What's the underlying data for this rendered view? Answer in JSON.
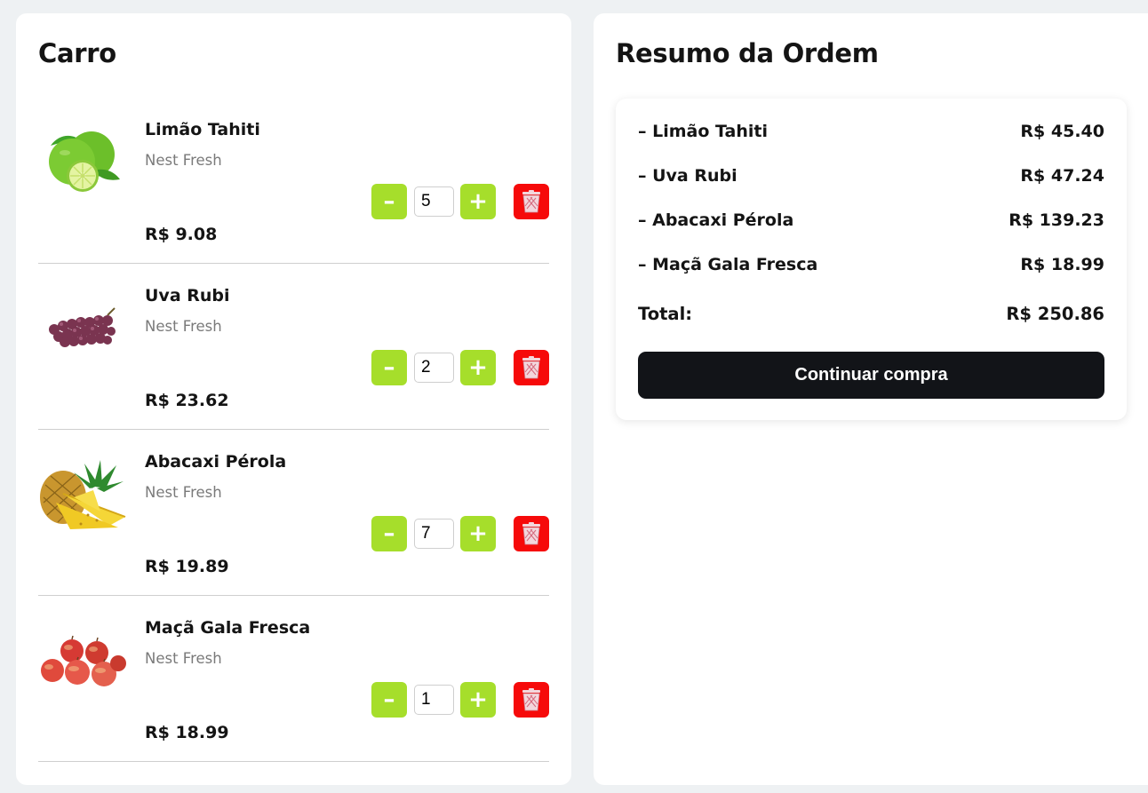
{
  "cart": {
    "title": "Carro",
    "items": [
      {
        "name": "Limão Tahiti",
        "brand": "Nest Fresh",
        "price": "R$ 9.08",
        "quantity": "5",
        "image": "lime-image"
      },
      {
        "name": "Uva Rubi",
        "brand": "Nest Fresh",
        "price": "R$ 23.62",
        "quantity": "2",
        "image": "grapes-image"
      },
      {
        "name": "Abacaxi Pérola",
        "brand": "Nest Fresh",
        "price": "R$ 19.89",
        "quantity": "7",
        "image": "pineapple-image"
      },
      {
        "name": "Maçã Gala Fresca",
        "brand": "Nest Fresh",
        "price": "R$ 18.99",
        "quantity": "1",
        "image": "apples-image"
      }
    ],
    "minus_label": "–",
    "plus_label": "+",
    "delete_icon": "trash-icon"
  },
  "summary": {
    "title": "Resumo da Ordem",
    "lines": [
      {
        "name": "– Limão Tahiti",
        "price": "R$ 45.40"
      },
      {
        "name": "– Uva Rubi",
        "price": "R$ 47.24"
      },
      {
        "name": "– Abacaxi Pérola",
        "price": "R$ 139.23"
      },
      {
        "name": "– Maçã Gala Fresca",
        "price": "R$ 18.99"
      }
    ],
    "total_label": "Total:",
    "total_value": "R$ 250.86",
    "checkout_label": "Continuar compra"
  },
  "colors": {
    "page_background": "#eef1f3",
    "quantity_button": "#a6de2b",
    "delete_button": "#f60a0a",
    "checkout_button": "#121418"
  }
}
